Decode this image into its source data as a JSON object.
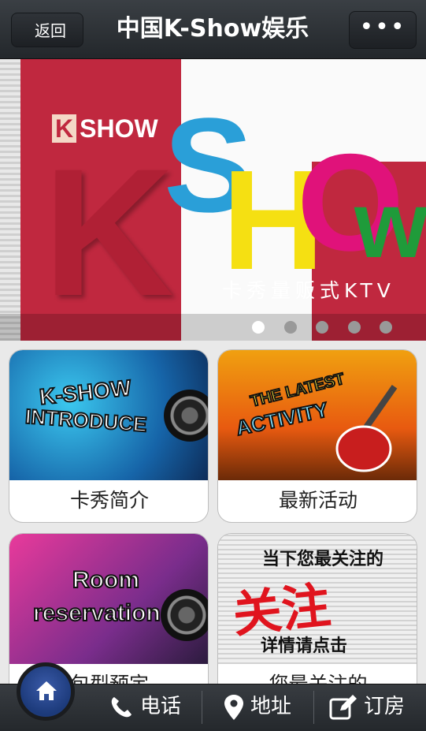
{
  "header": {
    "back_label": "返回",
    "title": "中国K-Show娱乐",
    "more_label": "•••"
  },
  "banner": {
    "logo_small_k": "K",
    "logo_small_text": "SHOW",
    "big_k": "K",
    "letters": [
      "S",
      "H",
      "O",
      "w"
    ],
    "tagline": "卡秀量贩式KTV",
    "slide_count": 5,
    "active_slide": 1
  },
  "cards": [
    {
      "label": "卡秀简介",
      "art_line1": "K-SHOW",
      "art_line2": "INTRODUCE"
    },
    {
      "label": "最新活动",
      "art_line1": "THE LATEST",
      "art_line2": "ACTIVITY"
    },
    {
      "label": "包型预定",
      "art_line1": "Room",
      "art_line2": "reservation"
    },
    {
      "label": "您最关注的",
      "art_line1": "当下您最关注的",
      "art_big": "关注",
      "art_line2": "详情请点击"
    }
  ],
  "bottom_bar": {
    "items": [
      {
        "label": "电话",
        "icon": "phone-icon"
      },
      {
        "label": "地址",
        "icon": "location-pin-icon"
      },
      {
        "label": "订房",
        "icon": "edit-icon"
      }
    ],
    "home_icon": "home-icon"
  }
}
